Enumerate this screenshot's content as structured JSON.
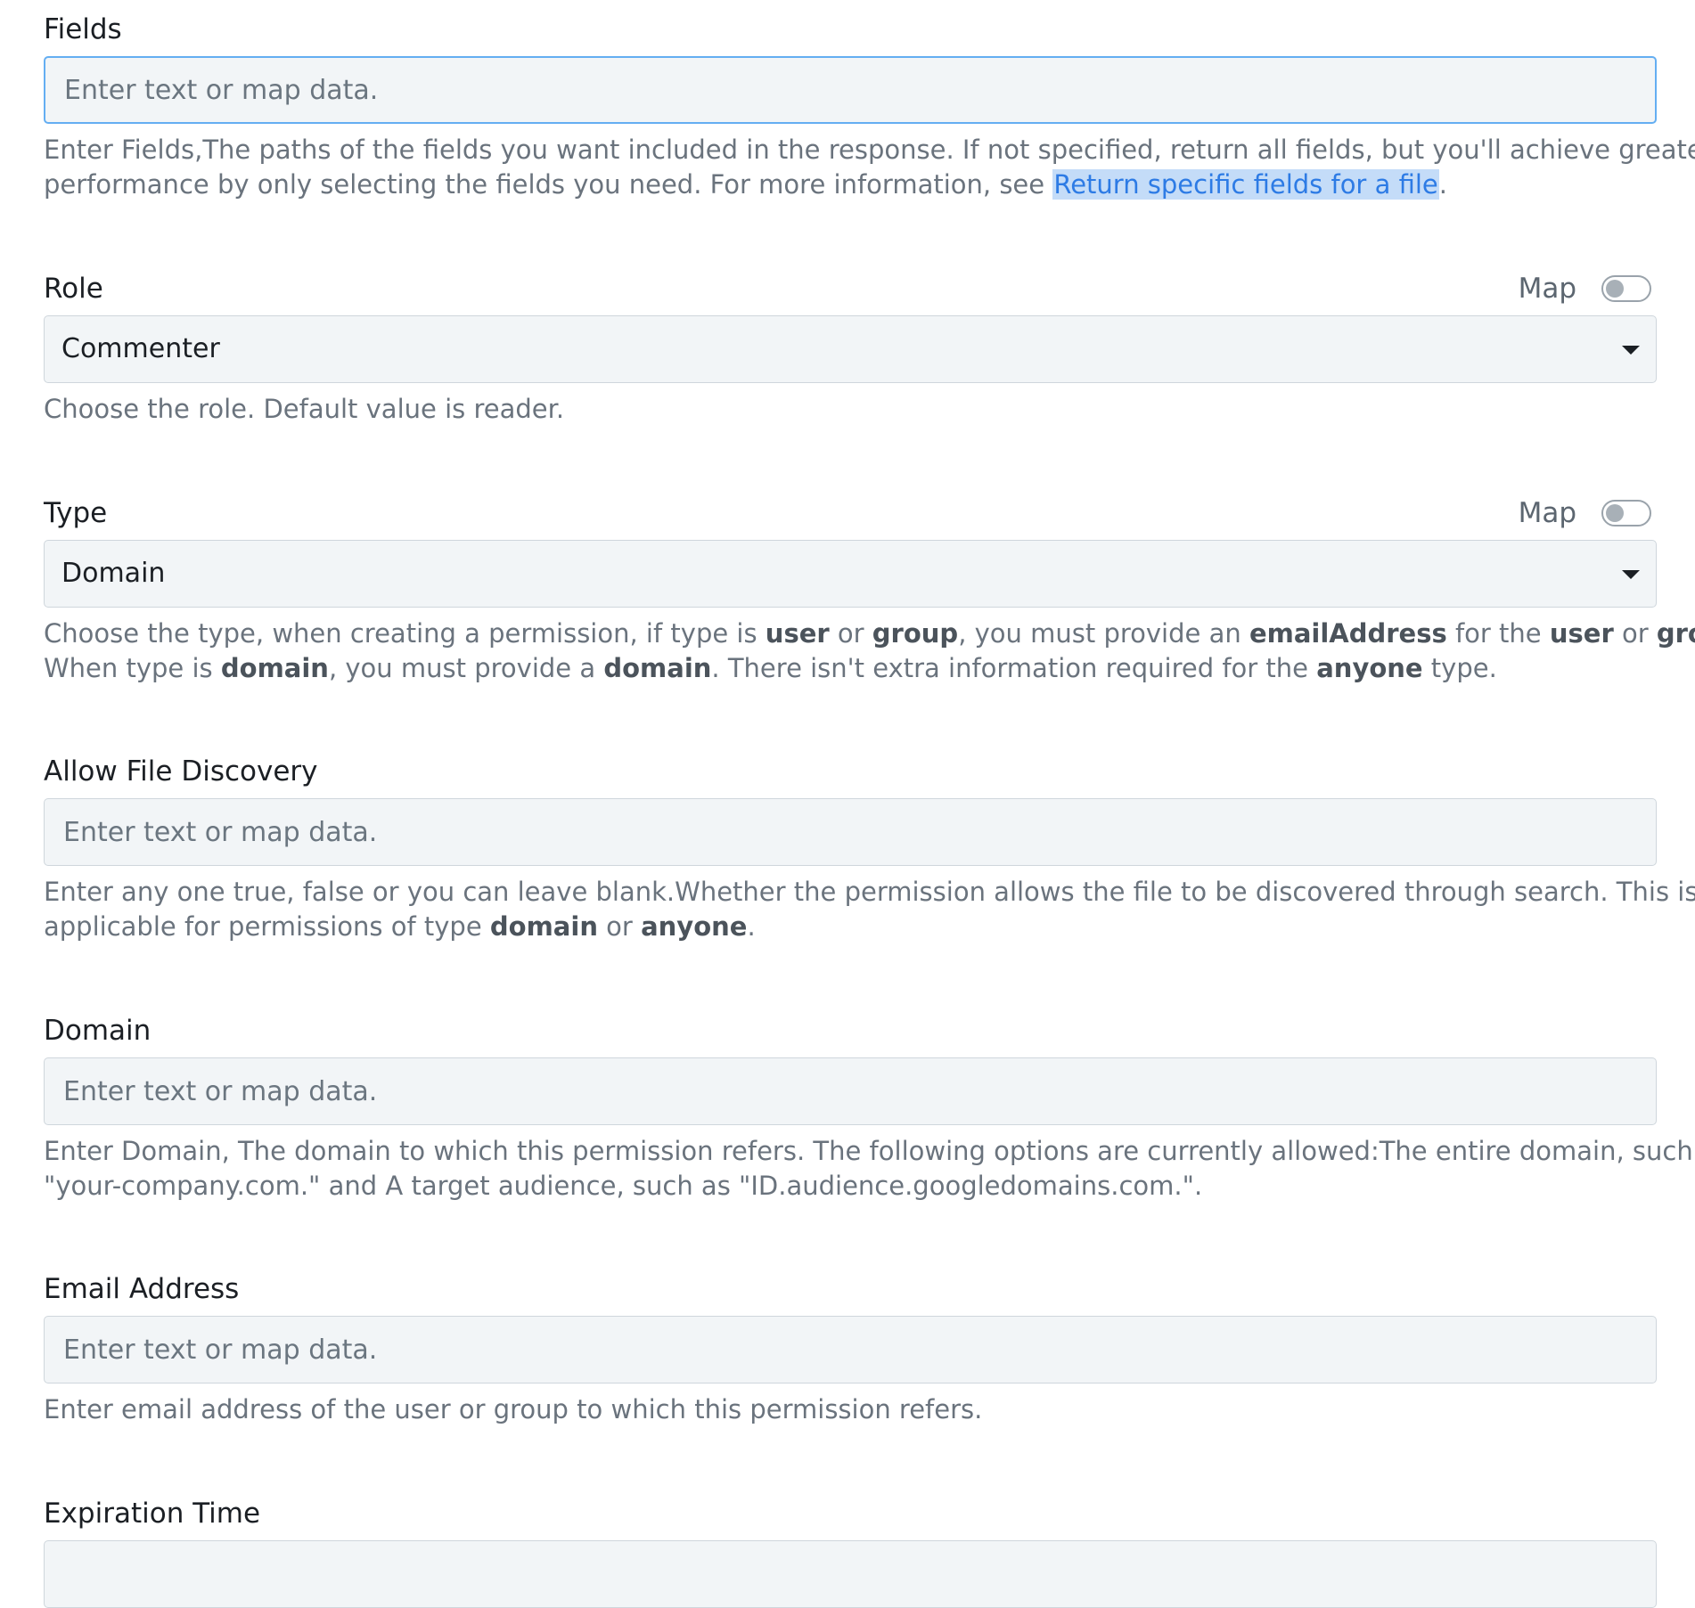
{
  "fields": {
    "label": "Fields",
    "placeholder": "Enter text or map data.",
    "help_before": "Enter Fields,The paths of the fields you want included in the response. If not specified, return all fields, but you'll achieve greater",
    "help_line2": "performance by only selecting the fields you need. For more information, see ",
    "help_link": "Return specific fields for a file",
    "help_after": "."
  },
  "role": {
    "label": "Role",
    "map_label": "Map",
    "value": "Commenter",
    "help": "Choose the role. Default value is reader."
  },
  "type": {
    "label": "Type",
    "map_label": "Map",
    "value": "Domain",
    "help": {
      "t1": "Choose the type, when creating a permission, if type is ",
      "b1": "user",
      "t2": " or ",
      "b2": "group",
      "t3": ", you must provide an ",
      "b3": "emailAddress",
      "t4": " for the ",
      "b4": "user",
      "t5": " or ",
      "b5": "group",
      "t6": ".",
      "t7": "When type is ",
      "b6": "domain",
      "t8": ", you must provide a ",
      "b7": "domain",
      "t9": ". There isn't extra information required for the ",
      "b8": "anyone",
      "t10": " type."
    }
  },
  "allow_file_discovery": {
    "label": "Allow File Discovery",
    "placeholder": "Enter text or map data.",
    "help": {
      "t1": "Enter any one true, false or you can leave blank.Whether the permission allows the file to be discovered through search. This is only",
      "t2": "applicable for permissions of type ",
      "b1": "domain",
      "t3": " or ",
      "b2": "anyone",
      "t4": "."
    }
  },
  "domain": {
    "label": "Domain",
    "placeholder": "Enter text or map data.",
    "help_line1": "Enter Domain, The domain to which this permission refers. The following options are currently allowed:The entire domain, such as",
    "help_line2": "\"your-company.com.\" and A target audience, such as \"ID.audience.googledomains.com.\"."
  },
  "email_address": {
    "label": "Email Address",
    "placeholder": "Enter text or map data.",
    "help": "Enter email address of the user or group to which this permission refers."
  },
  "expiration_time": {
    "label": "Expiration Time"
  },
  "colors": {
    "link": "#2d7be5",
    "link_highlight": "#c4dcf8",
    "focus_border": "#64aef2",
    "input_bg": "#f2f5f7"
  }
}
